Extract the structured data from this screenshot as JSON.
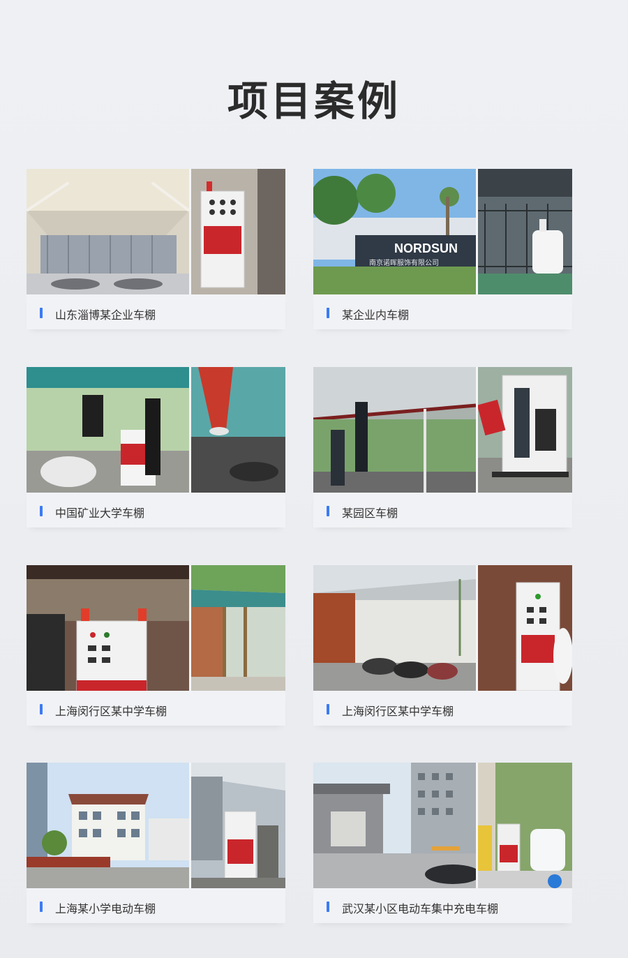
{
  "title": "项目案例",
  "colors": {
    "accent_bar": "#3b7bf5",
    "title": "#2b2b2b",
    "background": "#eef0f4"
  },
  "cases": [
    {
      "label": "山东淄博某企业车棚"
    },
    {
      "label": "某企业内车棚",
      "sign_text": "NORDSUN",
      "sign_subtext": "南京诺晖服饰有限公司"
    },
    {
      "label": "中国矿业大学车棚"
    },
    {
      "label": "某园区车棚"
    },
    {
      "label": "上海闵行区某中学车棚"
    },
    {
      "label": "上海闵行区某中学车棚"
    },
    {
      "label": "上海某小学电动车棚"
    },
    {
      "label": "武汉某小区电动车集中充电车棚"
    }
  ]
}
